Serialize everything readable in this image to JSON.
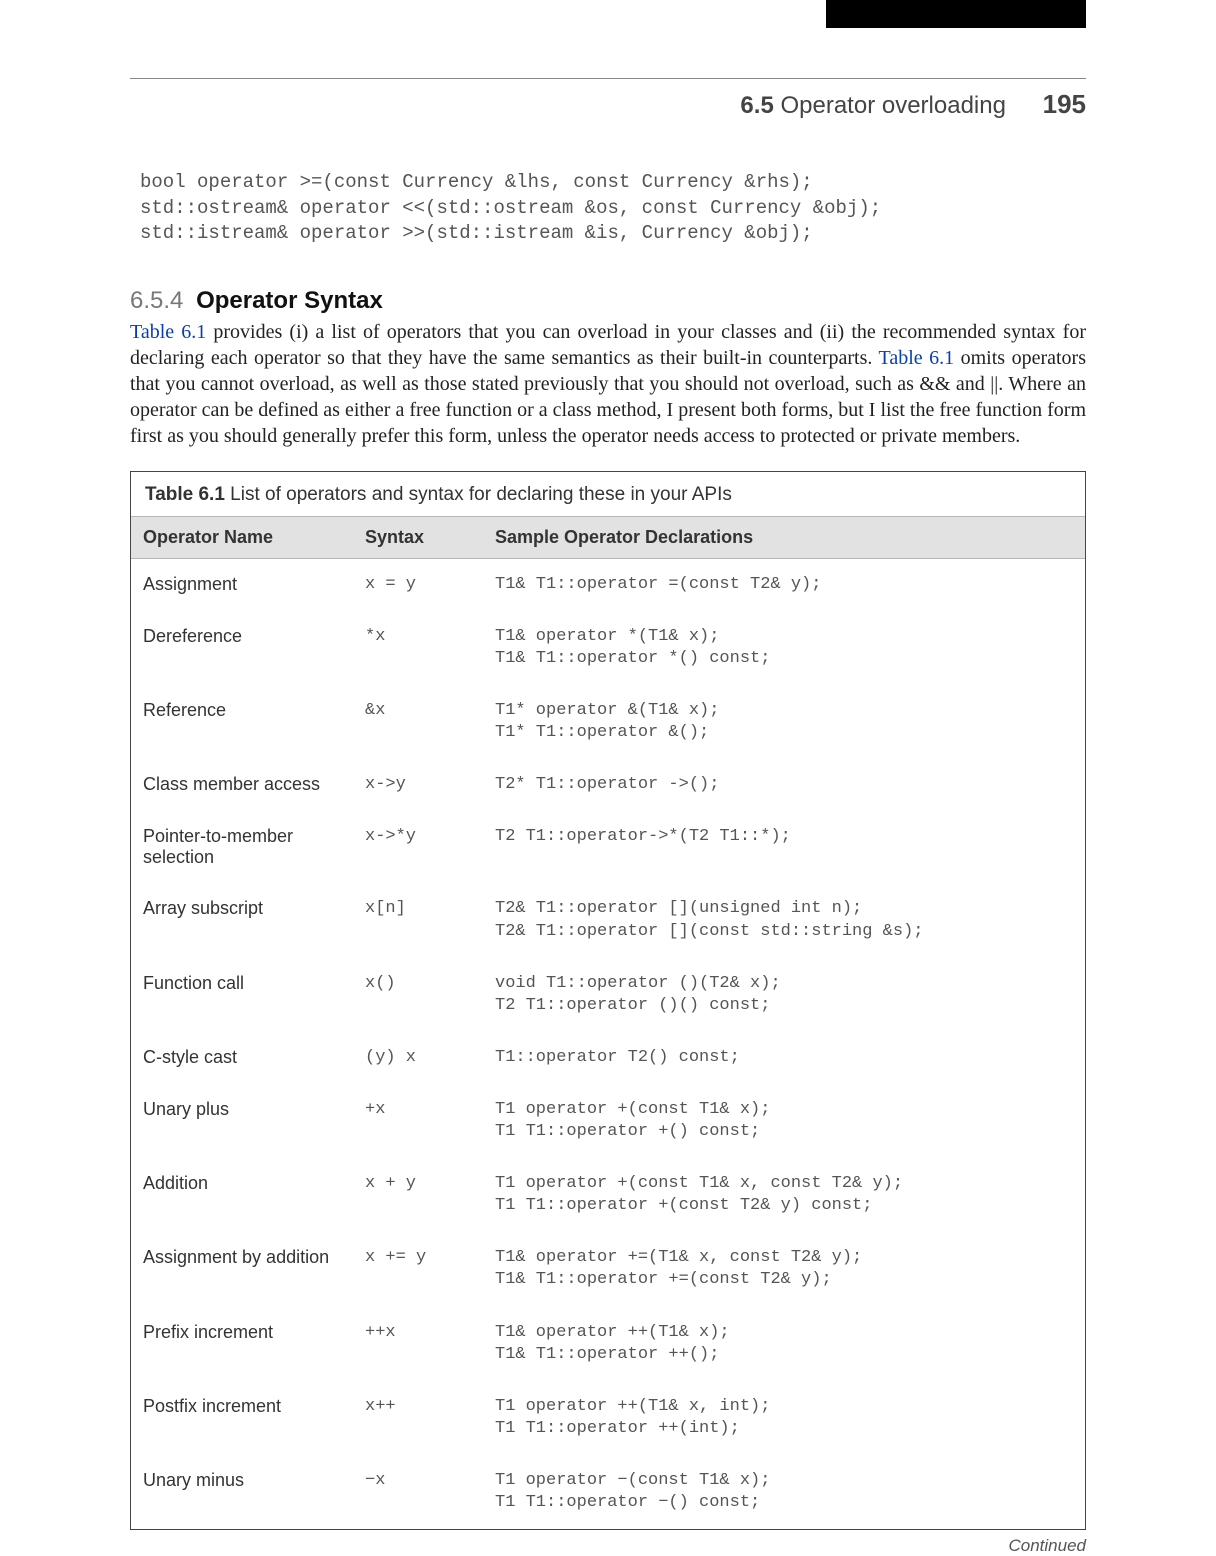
{
  "header": {
    "section_number": "6.5",
    "section_title": "Operator overloading",
    "page_number": "195"
  },
  "code_top": "bool operator >=(const Currency &lhs, const Currency &rhs);\nstd::ostream& operator <<(std::ostream &os, const Currency &obj);\nstd::istream& operator >>(std::istream &is, Currency &obj);",
  "subsection": {
    "number": "6.5.4",
    "title": "Operator Syntax"
  },
  "para": {
    "link1": "Table 6.1",
    "t1": " provides (i) a list of operators that you can overload in your classes and (ii) the recommended syntax for declaring each operator so that they have the same semantics as their built-in counterparts. ",
    "link2": "Table 6.1",
    "t2": " omits operators that you cannot overload, as well as those stated previously that you should not overload, such as && and ||. Where an operator can be defined as either a free function or a class method, I present both forms, but I list the free function form first as you should generally prefer this form, unless the operator needs access to protected or private members."
  },
  "table": {
    "caption_label": "Table 6.1",
    "caption_text": "  List of operators and syntax for declaring these in your APIs",
    "headers": {
      "c1": "Operator Name",
      "c2": "Syntax",
      "c3": "Sample Operator Declarations"
    },
    "rows": [
      {
        "name": "Assignment",
        "syntax": "x = y",
        "decl": "T1& T1::operator =(const T2& y);"
      },
      {
        "name": "Dereference",
        "syntax": "*x",
        "decl": "T1& operator *(T1& x);\nT1& T1::operator *() const;"
      },
      {
        "name": "Reference",
        "syntax": "&x",
        "decl": "T1* operator &(T1& x);\nT1* T1::operator &();"
      },
      {
        "name": "Class member access",
        "syntax": "x->y",
        "decl": "T2* T1::operator ->();"
      },
      {
        "name": "Pointer-to-member selection",
        "syntax": "x->*y",
        "decl": "T2 T1::operator->*(T2 T1::*);"
      },
      {
        "name": "Array subscript",
        "syntax": "x[n]",
        "decl": "T2& T1::operator [](unsigned int n);\nT2& T1::operator [](const std::string &s);"
      },
      {
        "name": "Function call",
        "syntax": "x()",
        "decl": "void T1::operator ()(T2& x);\nT2 T1::operator ()() const;"
      },
      {
        "name": "C-style cast",
        "syntax": "(y) x",
        "decl": "T1::operator T2() const;"
      },
      {
        "name": "Unary plus",
        "syntax": "+x",
        "decl": "T1 operator +(const T1& x);\nT1 T1::operator +() const;"
      },
      {
        "name": "Addition",
        "syntax": "x + y",
        "decl": "T1 operator +(const T1& x, const T2& y);\nT1 T1::operator +(const T2& y) const;"
      },
      {
        "name": "Assignment by addition",
        "syntax": "x += y",
        "decl": "T1& operator +=(T1& x, const T2& y);\nT1& T1::operator +=(const T2& y);"
      },
      {
        "name": "Prefix increment",
        "syntax": "++x",
        "decl": "T1& operator ++(T1& x);\nT1& T1::operator ++();"
      },
      {
        "name": "Postfix increment",
        "syntax": "x++",
        "decl": "T1 operator ++(T1& x, int);\nT1 T1::operator ++(int);"
      },
      {
        "name": "Unary minus",
        "syntax": "−x",
        "decl": "T1 operator −(const T1& x);\nT1 T1::operator −() const;"
      }
    ],
    "continued": "Continued"
  }
}
